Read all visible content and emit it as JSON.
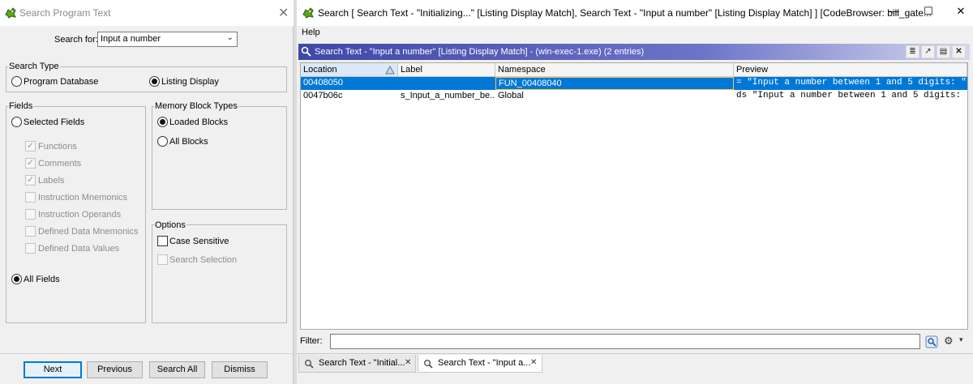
{
  "left": {
    "title": "Search Program Text",
    "search_for_label": "Search for:",
    "search_value": "Input a number",
    "search_type": {
      "legend": "Search Type",
      "program_database": "Program Database",
      "listing_display": "Listing Display"
    },
    "fields": {
      "legend": "Fields",
      "selected_fields": "Selected Fields",
      "functions": "Functions",
      "comments": "Comments",
      "labels": "Labels",
      "instruction_mnemonics": "Instruction Mnemonics",
      "instruction_operands": "Instruction Operands",
      "defined_data_mnemonics": "Defined Data Mnemonics",
      "defined_data_values": "Defined Data Values",
      "all_fields": "All Fields"
    },
    "memory_block_types": {
      "legend": "Memory Block Types",
      "loaded_blocks": "Loaded Blocks",
      "all_blocks": "All Blocks"
    },
    "options": {
      "legend": "Options",
      "case_sensitive": "Case Sensitive",
      "search_selection": "Search Selection"
    },
    "buttons": {
      "next": "Next",
      "previous": "Previous",
      "search_all": "Search All",
      "dismiss": "Dismiss"
    }
  },
  "right": {
    "title": "Search [ Search Text - \"Initializing...\"  [Listing Display Match], Search Text - \"Input a number\"  [Listing Display Match] ] [CodeBrowser: bill_gate...",
    "menu_help": "Help",
    "provider_title": "Search Text - \"Input a number\"  [Listing Display Match] - (win-exec-1.exe)     (2 entries)",
    "columns": [
      "Location",
      "Label",
      "Namespace",
      "Preview"
    ],
    "rows": [
      {
        "location": "00408050",
        "label": "",
        "namespace": "FUN_00408040",
        "preview": "= \"Input a number between 1 and 5 digits: \""
      },
      {
        "location": "0047b06c",
        "label": "s_Input_a_number_be...",
        "namespace": "Global",
        "preview": "ds \"Input a number between 1 and 5 digits: \""
      }
    ],
    "filter_label": "Filter:",
    "filter_value": "",
    "tabs": [
      {
        "label": "Search Text - \"Initial..."
      },
      {
        "label": "Search Text - \"Input a..."
      }
    ]
  },
  "colors": {
    "selection": "#0078d7",
    "header_gradient_start": "#3f47a8",
    "focus_border": "#f2c94c"
  }
}
